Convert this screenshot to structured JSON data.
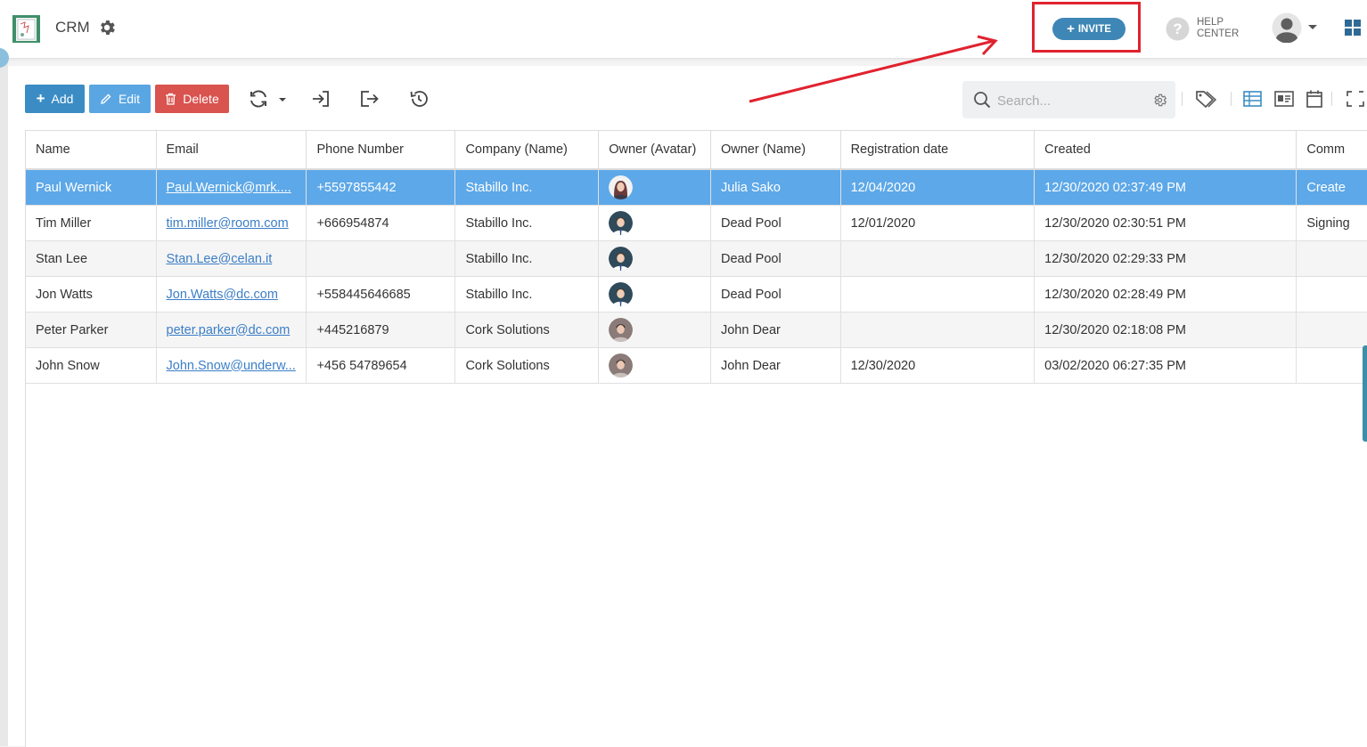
{
  "header": {
    "title": "CRM",
    "invite_label": "INVITE",
    "help_line1": "HELP",
    "help_line2": "CENTER"
  },
  "toolbar": {
    "add_label": "Add",
    "edit_label": "Edit",
    "delete_label": "Delete",
    "search_placeholder": "Search..."
  },
  "colors": {
    "add": "#3b8cc4",
    "edit": "#5aa6e2",
    "delete": "#d9534f",
    "selected_row": "#5da8e8",
    "invite": "#3d86b6",
    "annotation": "#e0232f"
  },
  "grid": {
    "columns": [
      "Name",
      "Email",
      "Phone Number",
      "Company (Name)",
      "Owner (Avatar)",
      "Owner (Name)",
      "Registration date",
      "Created",
      "Comm"
    ],
    "rows": [
      {
        "name": "Paul Wernick",
        "email": "Paul.Wernick@mrk....",
        "phone": "+5597855442",
        "company": "Stabillo Inc.",
        "avatar": "woman-avatar",
        "owner": "Julia Sako",
        "registration": "12/04/2020",
        "created": "12/30/2020 02:37:49 PM",
        "comment": "Create"
      },
      {
        "name": "Tim Miller",
        "email": "tim.miller@room.com",
        "phone": "+666954874",
        "company": "Stabillo Inc.",
        "avatar": "man-avatar",
        "owner": "Dead Pool",
        "registration": "12/01/2020",
        "created": "12/30/2020 02:30:51 PM",
        "comment": "Signing"
      },
      {
        "name": "Stan Lee",
        "email": "Stan.Lee@celan.it",
        "phone": "",
        "company": "Stabillo Inc.",
        "avatar": "man-avatar",
        "owner": "Dead Pool",
        "registration": "",
        "created": "12/30/2020 02:29:33 PM",
        "comment": ""
      },
      {
        "name": "Jon Watts",
        "email": "Jon.Watts@dc.com",
        "phone": "+558445646685",
        "company": "Stabillo Inc.",
        "avatar": "man-avatar",
        "owner": "Dead Pool",
        "registration": "",
        "created": "12/30/2020 02:28:49 PM",
        "comment": ""
      },
      {
        "name": "Peter Parker",
        "email": "peter.parker@dc.com",
        "phone": "+445216879",
        "company": "Cork Solutions",
        "avatar": "man-avatar-2",
        "owner": "John Dear",
        "registration": "",
        "created": "12/30/2020 02:18:08 PM",
        "comment": ""
      },
      {
        "name": "John Snow",
        "email": "John.Snow@underw...",
        "phone": "+456 54789654",
        "company": "Cork Solutions",
        "avatar": "man-avatar-2",
        "owner": "John Dear",
        "registration": "12/30/2020",
        "created": "03/02/2020 06:27:35 PM",
        "comment": ""
      }
    ]
  }
}
